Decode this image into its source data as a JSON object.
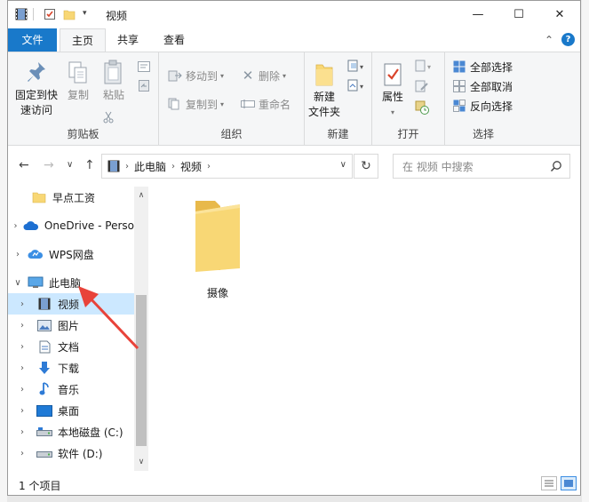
{
  "window": {
    "title": "视频",
    "controls": {
      "minimize": "—",
      "maximize": "☐",
      "close": "✕"
    }
  },
  "tabs": {
    "file": "文件",
    "home": "主页",
    "share": "共享",
    "view": "查看",
    "help": "?"
  },
  "ribbon": {
    "clipboard": {
      "label": "剪贴板",
      "pin_line1": "固定到快",
      "pin_line2": "速访问",
      "copy": "复制",
      "paste": "粘贴"
    },
    "organize": {
      "label": "组织",
      "move_to": "移动到",
      "copy_to": "复制到",
      "delete": "删除",
      "rename": "重命名"
    },
    "new": {
      "label": "新建",
      "new_folder_line1": "新建",
      "new_folder_line2": "文件夹"
    },
    "open": {
      "label": "打开",
      "properties": "属性"
    },
    "select": {
      "label": "选择",
      "select_all": "全部选择",
      "select_none": "全部取消",
      "invert": "反向选择"
    }
  },
  "address": {
    "path": [
      "此电脑",
      "视频"
    ],
    "search_placeholder": "在 视频 中搜索"
  },
  "nav_pane": {
    "items": [
      {
        "label": "早点工资",
        "icon": "folder-icon"
      },
      {
        "label": "OneDrive - Perso",
        "icon": "onedrive-icon"
      },
      {
        "label": "WPS网盘",
        "icon": "cloud-icon"
      },
      {
        "label": "此电脑",
        "icon": "computer-icon"
      },
      {
        "label": "视频",
        "icon": "video-icon"
      },
      {
        "label": "图片",
        "icon": "pictures-icon"
      },
      {
        "label": "文档",
        "icon": "documents-icon"
      },
      {
        "label": "下载",
        "icon": "download-icon"
      },
      {
        "label": "音乐",
        "icon": "music-icon"
      },
      {
        "label": "桌面",
        "icon": "desktop-icon"
      },
      {
        "label": "本地磁盘 (C:)",
        "icon": "drive-icon"
      },
      {
        "label": "软件 (D:)",
        "icon": "drive-icon"
      }
    ]
  },
  "content": {
    "items": [
      {
        "label": "摄像",
        "icon": "folder-icon"
      }
    ]
  },
  "status": {
    "count": "1 个项目"
  },
  "colors": {
    "accent": "#1979ca",
    "selection": "#cce8ff",
    "folder": "#f8d775",
    "annotation_arrow": "#e8433a"
  }
}
